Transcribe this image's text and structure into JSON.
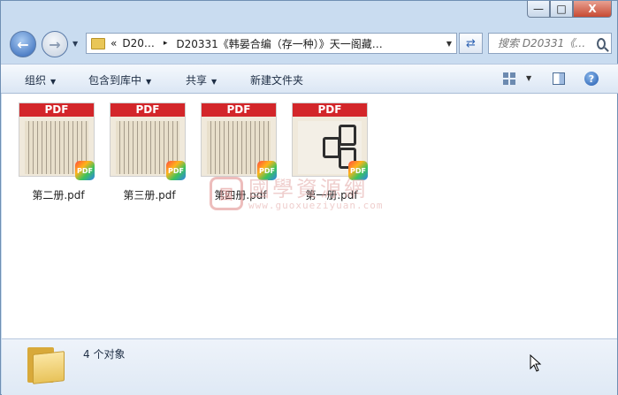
{
  "window": {
    "controls": {
      "minimize": "—",
      "maximize": "□",
      "close": "X"
    }
  },
  "nav": {
    "breadcrumb_overflow": "«",
    "breadcrumb_root": "D20…",
    "breadcrumb_sep": "▸",
    "breadcrumb_current": "D20331《韩晏合编（存一种）》天一阁藏…",
    "search_placeholder": "搜索 D20331《…"
  },
  "toolbar": {
    "organize": "组织",
    "include_in_library": "包含到库中",
    "share": "共享",
    "new_folder": "新建文件夹"
  },
  "files": [
    {
      "name": "第二册.pdf",
      "band": "PDF",
      "badge": "PDF",
      "icon": "pdf-thumbnail-icon"
    },
    {
      "name": "第三册.pdf",
      "band": "PDF",
      "badge": "PDF",
      "icon": "pdf-thumbnail-icon"
    },
    {
      "name": "第四册.pdf",
      "band": "PDF",
      "badge": "PDF",
      "icon": "pdf-thumbnail-icon"
    },
    {
      "name": "第一册.pdf",
      "band": "PDF",
      "badge": "PDF",
      "icon": "pdf-thumbnail-icon"
    }
  ],
  "watermark": {
    "seal": "国",
    "text": "國學資源網",
    "url": "www.guoxueziyuan.com"
  },
  "details": {
    "count": "4 个对象"
  }
}
